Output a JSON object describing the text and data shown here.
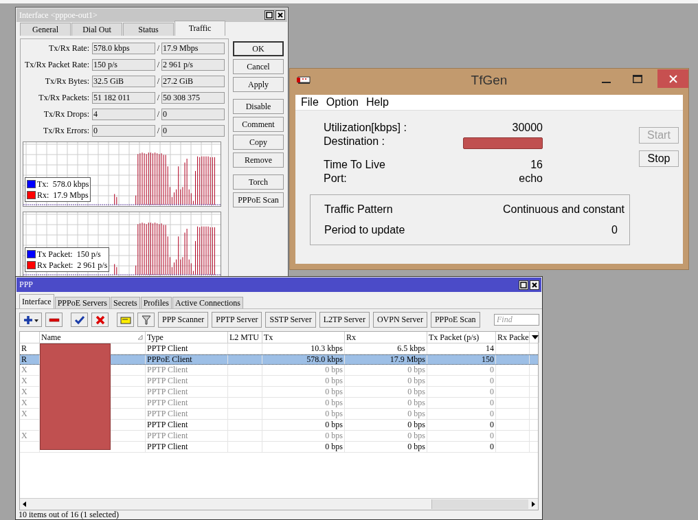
{
  "interface_window": {
    "title": "Interface <pppoe-out1>",
    "tabs": [
      {
        "label": "General",
        "selected": false
      },
      {
        "label": "Dial Out",
        "selected": false
      },
      {
        "label": "Status",
        "selected": false
      },
      {
        "label": "Traffic",
        "selected": true
      }
    ],
    "stats": [
      {
        "label": "Tx/Rx Rate:",
        "tx": "578.0 kbps",
        "separator": "/",
        "rx": "17.9 Mbps"
      },
      {
        "label": "Tx/Rx Packet Rate:",
        "tx": "150 p/s",
        "separator": "/",
        "rx": "2 961 p/s"
      },
      {
        "label": "Tx/Rx Bytes:",
        "tx": "32.5 GiB",
        "separator": "/",
        "rx": "27.2 GiB"
      },
      {
        "label": "Tx/Rx Packets:",
        "tx": "51 182 011",
        "separator": "/",
        "rx": "50 308 375"
      },
      {
        "label": "Tx/Rx Drops:",
        "tx": "4",
        "separator": "/",
        "rx": "0"
      },
      {
        "label": "Tx/Rx Errors:",
        "tx": "0",
        "separator": "/",
        "rx": "0"
      }
    ],
    "graphs": [
      {
        "legend": [
          {
            "label": "Tx:",
            "value": "578.0 kbps",
            "color": "#0000ff"
          },
          {
            "label": "Rx:",
            "value": "17.9 Mbps",
            "color": "#ff0000"
          }
        ]
      },
      {
        "legend": [
          {
            "label": "Tx Packet:",
            "value": "150 p/s",
            "color": "#0000ff"
          },
          {
            "label": "Rx Packet:",
            "value": "2 961 p/s",
            "color": "#ff0000"
          }
        ]
      }
    ],
    "buttons": [
      {
        "label": "OK",
        "default": true
      },
      {
        "label": "Cancel",
        "default": false
      },
      {
        "label": "Apply",
        "default": false
      },
      {
        "label": "Disable",
        "default": false
      },
      {
        "label": "Comment",
        "default": false
      },
      {
        "label": "Copy",
        "default": false
      },
      {
        "label": "Remove",
        "default": false
      },
      {
        "label": "Torch",
        "default": false
      },
      {
        "label": "PPPoE Scan",
        "default": false
      }
    ]
  },
  "tfgen_window": {
    "title": "TfGen",
    "menu": [
      "File",
      "Option",
      "Help"
    ],
    "target": [
      {
        "label": "Utilization[kbps] :",
        "kind": "text",
        "value": "30000"
      },
      {
        "label": "Destination :",
        "kind": "redacted"
      }
    ],
    "options": [
      {
        "label": "Time To Live",
        "kind": "text",
        "value": "16"
      },
      {
        "label": "Port:",
        "kind": "text",
        "value": "echo"
      }
    ],
    "pattern_box": [
      {
        "label": "Traffic Pattern",
        "value": "Continuous and constant"
      },
      {
        "label": "Period to update",
        "value": "0"
      }
    ],
    "buttons": [
      {
        "label": "Start",
        "disabled": true
      },
      {
        "label": "Stop",
        "disabled": false
      }
    ]
  },
  "ppp_window": {
    "title": "PPP",
    "tabs": [
      {
        "label": "Interface",
        "selected": true
      },
      {
        "label": "PPPoE Servers",
        "selected": false
      },
      {
        "label": "Secrets",
        "selected": false
      },
      {
        "label": "Profiles",
        "selected": false
      },
      {
        "label": "Active Connections",
        "selected": false
      }
    ],
    "toolbar_buttons": [
      "PPP Scanner",
      "PPTP Server",
      "SSTP Server",
      "L2TP Server",
      "OVPN Server",
      "PPPoE Scan"
    ],
    "search": {
      "placeholder": "Find"
    },
    "table": {
      "columns": [
        "Name",
        "Type",
        "L2 MTU",
        "Tx",
        "Rx",
        "Tx Packet (p/s)",
        "Rx Packe"
      ],
      "rows": [
        {
          "flag": "R",
          "type": "PPTP Client",
          "tx": "10.3 kbps",
          "rx": "6.5 kbps",
          "tx_packet": "14",
          "disabled": false,
          "selected": false
        },
        {
          "flag": "R",
          "type": "PPPoE Client",
          "tx": "578.0 kbps",
          "rx": "17.9 Mbps",
          "tx_packet": "150",
          "disabled": false,
          "selected": true
        },
        {
          "flag": "X",
          "type": "PPTP Client",
          "tx": "0 bps",
          "rx": "0 bps",
          "tx_packet": "0",
          "disabled": true,
          "selected": false
        },
        {
          "flag": "X",
          "type": "PPTP Client",
          "tx": "0 bps",
          "rx": "0 bps",
          "tx_packet": "0",
          "disabled": true,
          "selected": false
        },
        {
          "flag": "X",
          "type": "PPTP Client",
          "tx": "0 bps",
          "rx": "0 bps",
          "tx_packet": "0",
          "disabled": true,
          "selected": false
        },
        {
          "flag": "X",
          "type": "PPTP Client",
          "tx": "0 bps",
          "rx": "0 bps",
          "tx_packet": "0",
          "disabled": true,
          "selected": false
        },
        {
          "flag": "X",
          "type": "PPTP Client",
          "tx": "0 bps",
          "rx": "0 bps",
          "tx_packet": "0",
          "disabled": true,
          "selected": false
        },
        {
          "type": "PPTP Client",
          "tx": "0 bps",
          "rx": "0 bps",
          "tx_packet": "0",
          "disabled": false,
          "selected": false
        },
        {
          "flag": "X",
          "type": "PPTP Client",
          "tx": "0 bps",
          "rx": "0 bps",
          "tx_packet": "0",
          "disabled": true,
          "selected": false
        },
        {
          "type": "PPTP Client",
          "tx": "0 bps",
          "rx": "0 bps",
          "tx_packet": "0",
          "disabled": false,
          "selected": false
        }
      ]
    },
    "status_bar": "10 items out of 16 (1 selected)"
  }
}
